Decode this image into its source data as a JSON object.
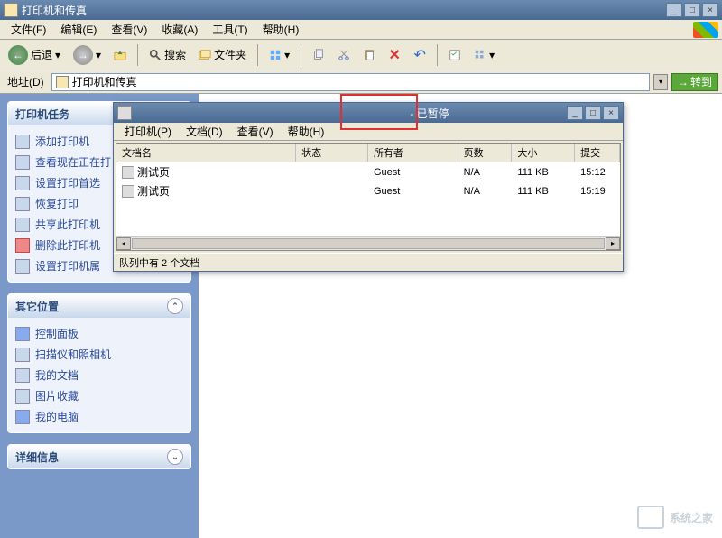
{
  "window": {
    "title": "打印机和传真",
    "minimize": "_",
    "maximize": "□",
    "close": "×"
  },
  "menu": {
    "file": "文件(F)",
    "edit": "编辑(E)",
    "view": "查看(V)",
    "favorites": "收藏(A)",
    "tools": "工具(T)",
    "help": "帮助(H)"
  },
  "toolbar": {
    "back": "后退",
    "search": "搜索",
    "folders": "文件夹"
  },
  "address": {
    "label": "地址(D)",
    "value": "打印机和传真",
    "go": "转到"
  },
  "sidebar": {
    "panel1_title": "打印机任务",
    "tasks": [
      "添加打印机",
      "查看现在正在打",
      "设置打印首选",
      "恢复打印",
      "共享此打印机",
      "删除此打印机",
      "设置打印机属"
    ],
    "panel2_title": "其它位置",
    "places": [
      "控制面板",
      "扫描仪和照相机",
      "我的文档",
      "图片收藏",
      "我的电脑"
    ],
    "panel3_title": "详细信息"
  },
  "child": {
    "title_suffix": "- 已暂停",
    "menu": {
      "printer": "打印机(P)",
      "document": "文档(D)",
      "view": "查看(V)",
      "help": "帮助(H)"
    },
    "columns": {
      "docname": "文档名",
      "status": "状态",
      "owner": "所有者",
      "pages": "页数",
      "size": "大小",
      "submitted": "提交"
    },
    "rows": [
      {
        "name": "测试页",
        "status": "",
        "owner": "Guest",
        "pages": "N/A",
        "size": "111 KB",
        "time": "15:12"
      },
      {
        "name": "测试页",
        "status": "",
        "owner": "Guest",
        "pages": "N/A",
        "size": "111 KB",
        "time": "15:19"
      }
    ],
    "status": "队列中有 2 个文档"
  },
  "watermark": "系统之家"
}
